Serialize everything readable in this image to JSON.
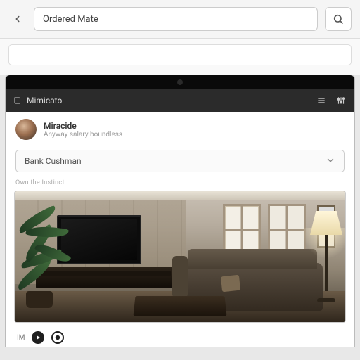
{
  "topbar": {
    "url_text": "Ordered Mate",
    "search_icon": "search-icon",
    "back_icon": "chevron-left-icon"
  },
  "app": {
    "header": {
      "title": "Mimicato",
      "title_icon": "book-icon",
      "menu_icon": "list-icon",
      "tools_icon": "equalizer-icon"
    },
    "profile": {
      "name": "Miracide",
      "subtitle": "Anyway salary boundless"
    },
    "dropdown": {
      "selected": "Bank Cushman",
      "chevron": "chevron-down-icon"
    },
    "caption": "Own the Instinct",
    "controls": {
      "label_left": "IM",
      "play_icon": "play-icon",
      "record_icon": "record-icon"
    }
  }
}
